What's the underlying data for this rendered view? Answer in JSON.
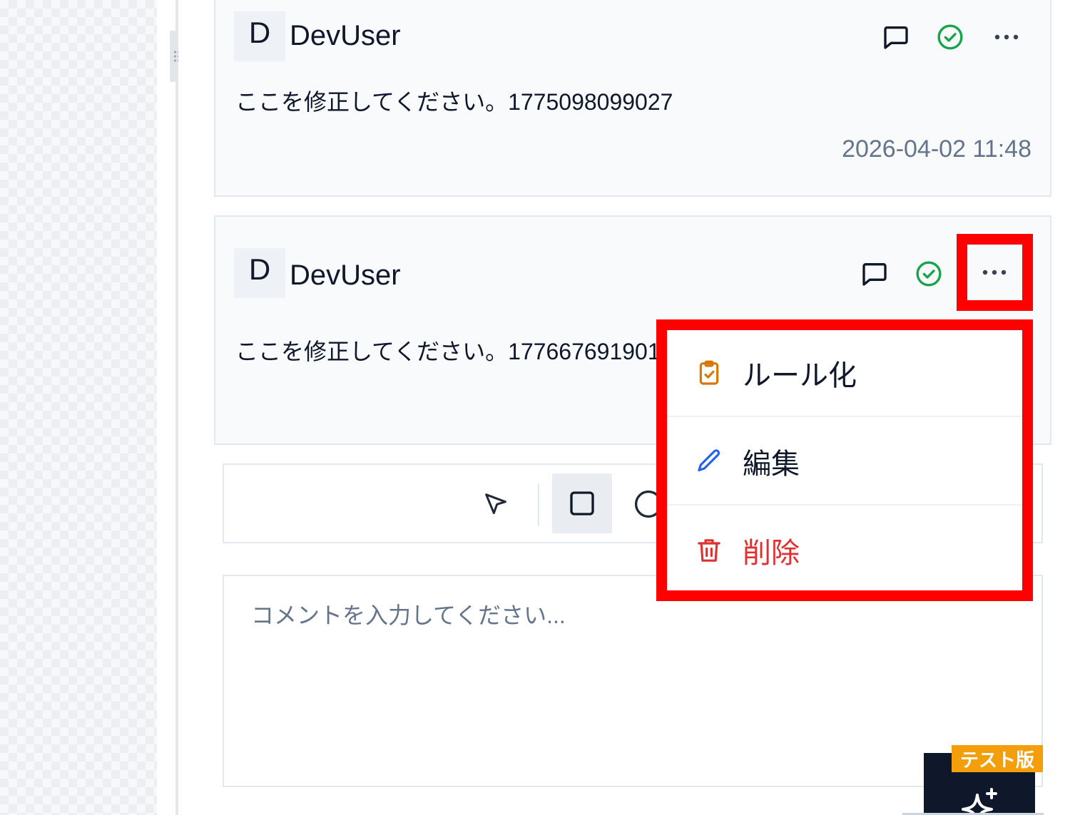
{
  "comments": [
    {
      "avatar_initial": "D",
      "author": "DevUser",
      "body": "ここを修正してください。1775098099027",
      "timestamp": "2026-04-02 11:48"
    },
    {
      "avatar_initial": "D",
      "author": "DevUser",
      "body": "ここを修正してください。177667691901"
    }
  ],
  "context_menu": {
    "items": [
      {
        "label": "ルール化",
        "icon": "clipboard-check-icon",
        "color": "#d97706"
      },
      {
        "label": "編集",
        "icon": "pencil-icon",
        "color": "#2563eb"
      },
      {
        "label": "削除",
        "icon": "trash-icon",
        "color": "#e03131"
      }
    ]
  },
  "toolbar": {
    "tools": [
      "cursor-icon",
      "rectangle-icon",
      "circle-icon"
    ],
    "active_tool": "rectangle-icon"
  },
  "comment_input": {
    "placeholder": "コメントを入力してください...",
    "value": ""
  },
  "ai_assistant": {
    "badge": "テスト版",
    "icon": "sparkle-icon"
  },
  "colors": {
    "resolve_green": "#16a34a",
    "highlight_red": "#ff0000",
    "badge_amber": "#f59e0b",
    "delete_red": "#e03131"
  }
}
